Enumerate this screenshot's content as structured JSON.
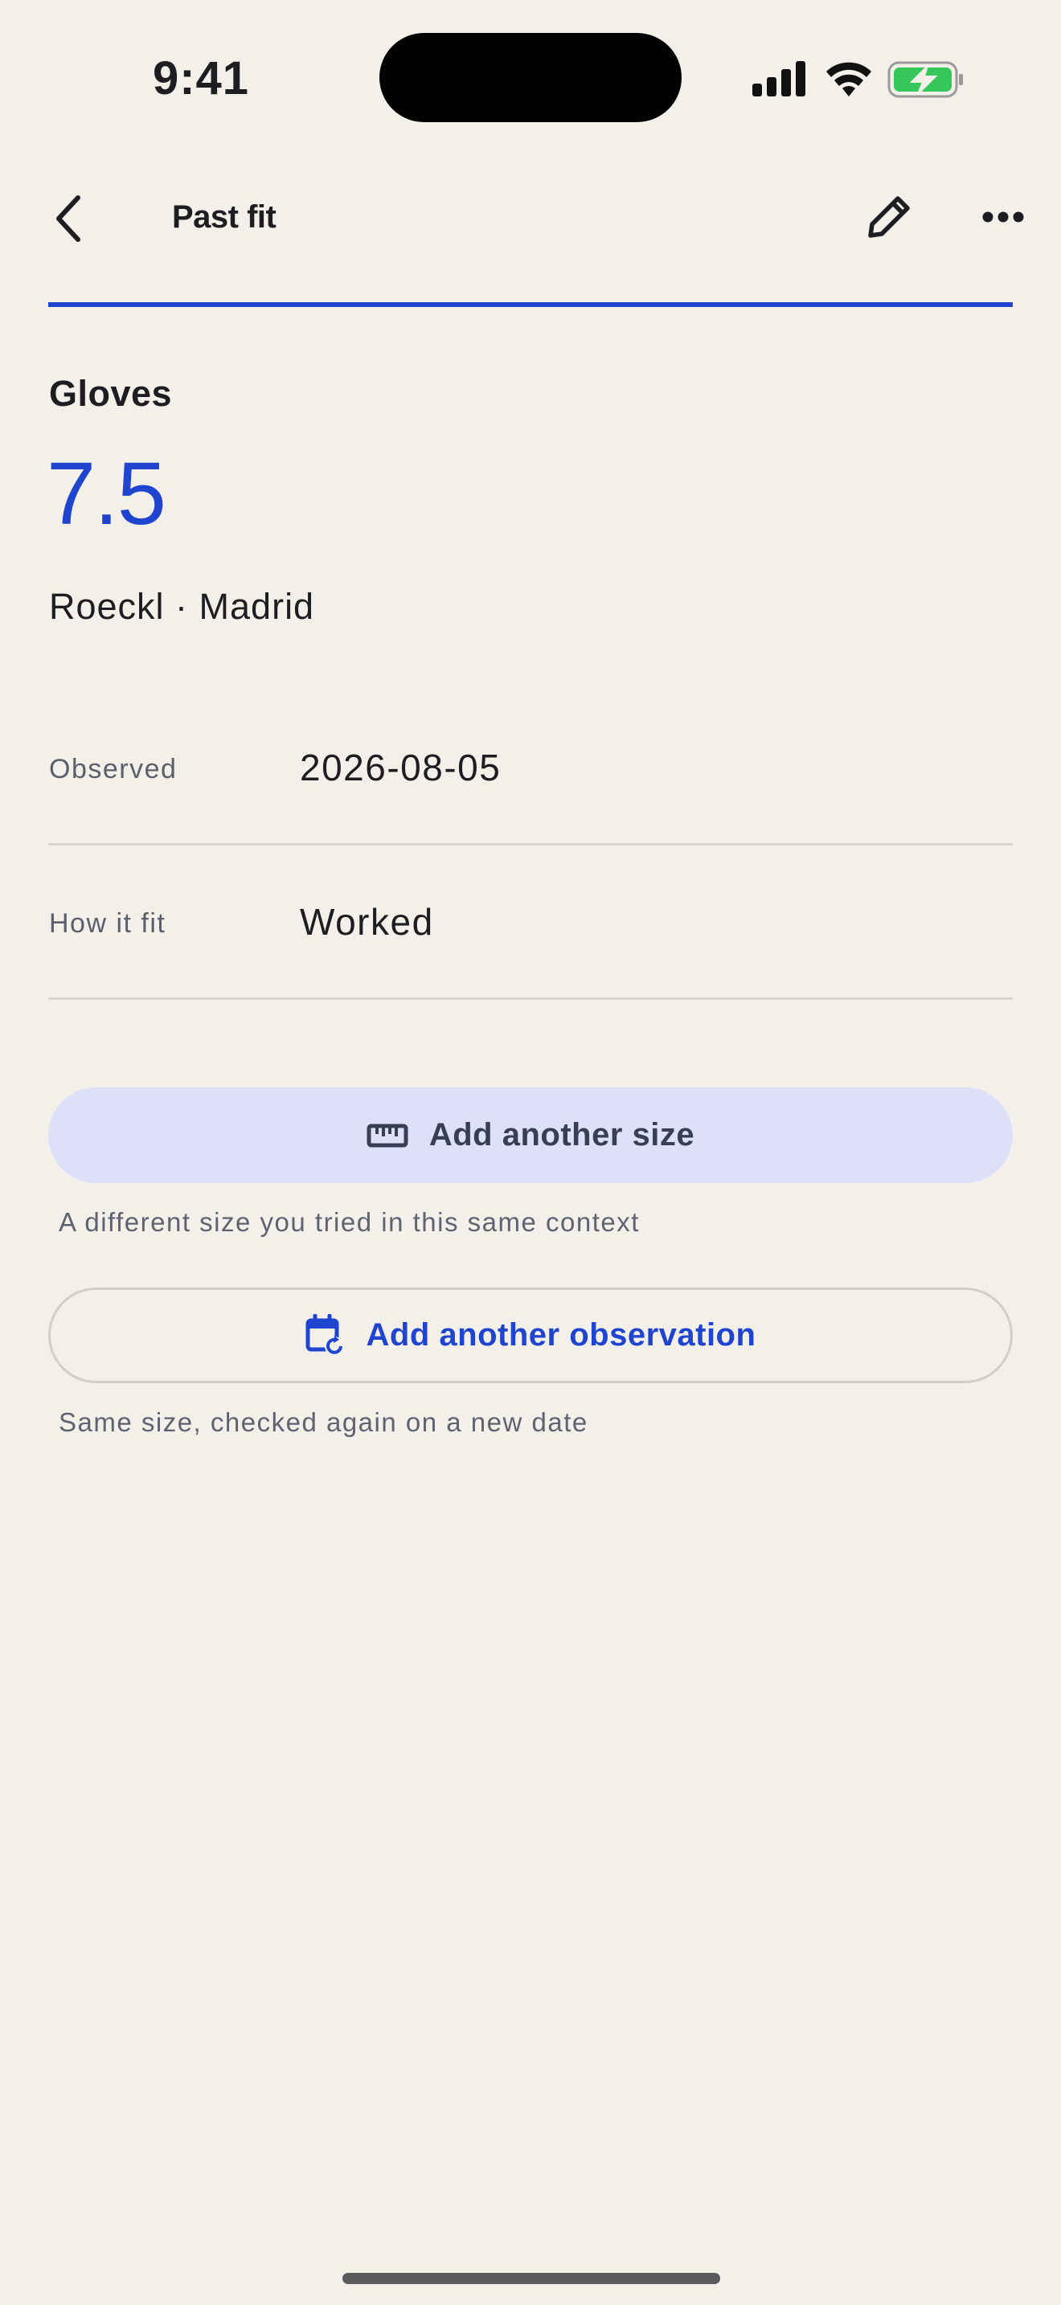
{
  "status_bar": {
    "time": "9:41",
    "battery_color": "#35C759"
  },
  "nav": {
    "title": "Past fit",
    "accent_color": "#1F45D0"
  },
  "item": {
    "category": "Gloves",
    "size": "7.5",
    "brand_location": "Roeckl · Madrid"
  },
  "details": [
    {
      "label": "Observed",
      "value": "2026-08-05"
    },
    {
      "label": "How it fit",
      "value": "Worked"
    }
  ],
  "actions": {
    "add_size": {
      "label": "Add another size",
      "hint": "A different size you tried in this same context",
      "icon": "ruler-icon"
    },
    "add_observation": {
      "label": "Add another observation",
      "hint": "Same size, checked again on a new date",
      "icon": "calendar-repeat-icon"
    }
  }
}
